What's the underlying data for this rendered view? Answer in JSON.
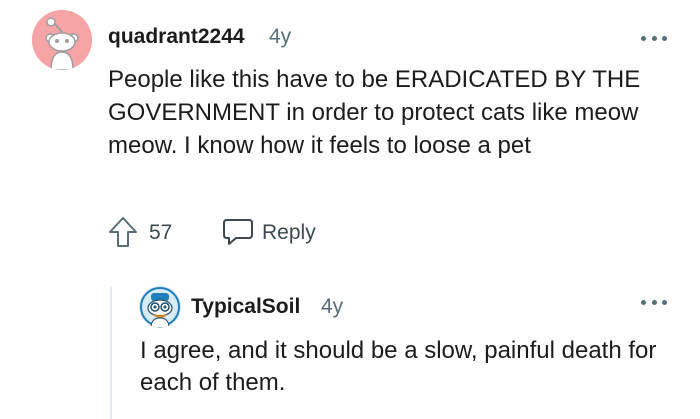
{
  "comment": {
    "username": "quadrant2244",
    "age": "4y",
    "body": "People like this have to be ERADICATED BY THE GOVERNMENT in order to protect cats like meow meow. I know how it feels to loose a pet",
    "votes": "57",
    "reply_label": "Reply",
    "avatar_icon": "snoo-avatar-icon",
    "avatar_color": "#f7a4a7"
  },
  "reply": {
    "username": "TypicalSoil",
    "age": "4y",
    "body": "I agree, and it should be a slow, painful death for each of them.",
    "avatar_icon": "snoo-avatar-icon",
    "avatar_color": "#d8ecf7"
  },
  "colors": {
    "text": "#1c1c1c",
    "meta": "#576f76",
    "thread_line": "#e5ebee"
  }
}
